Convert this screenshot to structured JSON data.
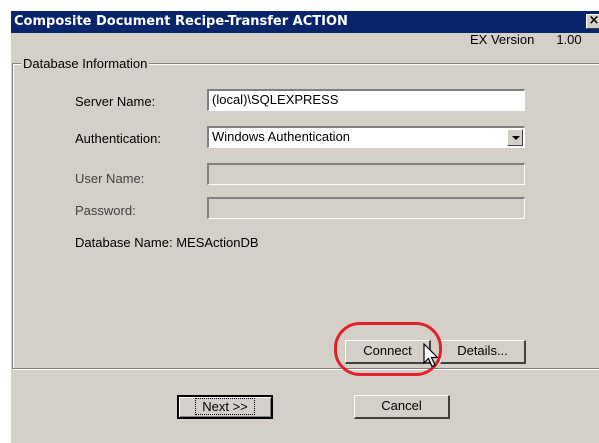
{
  "window": {
    "title": "Composite Document Recipe-Transfer ACTION"
  },
  "version": {
    "label": "EX Version",
    "number": "1.00"
  },
  "database_info": {
    "legend": "Database Information",
    "server_name": {
      "label": "Server Name:",
      "value": "(local)\\SQLEXPRESS"
    },
    "authentication": {
      "label": "Authentication:",
      "value": "Windows Authentication"
    },
    "user_name": {
      "label": "User Name:",
      "value": ""
    },
    "password": {
      "label": "Password:",
      "value": ""
    },
    "database_name": {
      "label": "Database Name:",
      "value": "MESActionDB"
    },
    "connect_label": "Connect",
    "details_label": "Details..."
  },
  "footer": {
    "next_label": "Next >>",
    "cancel_label": "Cancel"
  },
  "colors": {
    "titlebar": "#08246b",
    "highlight": "#e0202a",
    "face": "#d4d0c8"
  }
}
